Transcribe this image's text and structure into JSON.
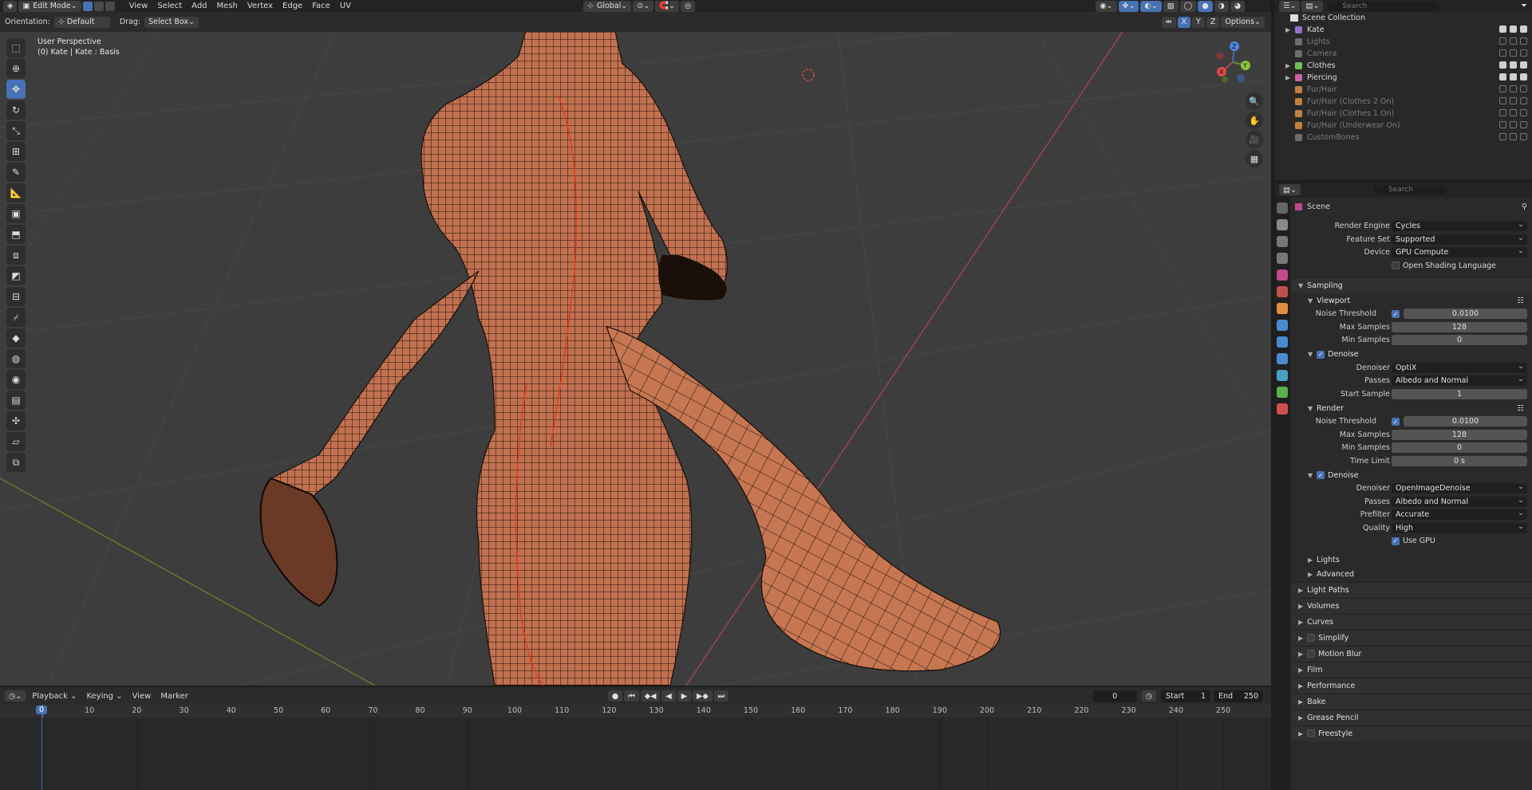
{
  "header": {
    "mode": "Edit Mode",
    "menus": [
      "View",
      "Select",
      "Add",
      "Mesh",
      "Vertex",
      "Edge",
      "Face",
      "UV"
    ],
    "transform_orientation": "Global",
    "options": "Options",
    "axes": [
      "X",
      "Y",
      "Z"
    ]
  },
  "tool_settings": {
    "orientation_label": "Orientation:",
    "orientation_value": "Default",
    "drag_label": "Drag:",
    "drag_value": "Select Box"
  },
  "viewport": {
    "info_line1": "User Perspective",
    "info_line2": "(0) Kate | Kate : Basis",
    "gizmo_axes": [
      "X",
      "Y",
      "Z"
    ]
  },
  "timeline": {
    "menus": [
      "Playback",
      "Keying",
      "View",
      "Marker"
    ],
    "current_frame": "0",
    "start_label": "Start",
    "start_value": "1",
    "end_label": "End",
    "end_value": "250",
    "ticks": [
      "0",
      "10",
      "20",
      "30",
      "40",
      "50",
      "60",
      "70",
      "80",
      "90",
      "100",
      "110",
      "120",
      "130",
      "140",
      "150",
      "160",
      "170",
      "180",
      "190",
      "200",
      "210",
      "220",
      "230",
      "240",
      "250"
    ]
  },
  "outliner": {
    "search_placeholder": "Search",
    "root": "Scene Collection",
    "items": [
      {
        "name": "Kate",
        "dim": false,
        "color": "#9a6fd0",
        "expand": true
      },
      {
        "name": "Lights",
        "dim": true,
        "color": "#6e6e6e",
        "expand": false
      },
      {
        "name": "Camera",
        "dim": true,
        "color": "#6e6e6e",
        "expand": false
      },
      {
        "name": "Clothes",
        "dim": false,
        "color": "#6fbf5a",
        "expand": true
      },
      {
        "name": "Piercing",
        "dim": false,
        "color": "#d05fa6",
        "expand": true
      },
      {
        "name": "Fur/Hair",
        "dim": true,
        "color": "#c08040",
        "expand": false
      },
      {
        "name": "Fur/Hair (Clothes 2 On)",
        "dim": true,
        "color": "#c08040",
        "expand": false
      },
      {
        "name": "Fur/Hair (Clothes 1 On)",
        "dim": true,
        "color": "#c08040",
        "expand": false
      },
      {
        "name": "Fur/Hair (Underwear On)",
        "dim": true,
        "color": "#c08040",
        "expand": false
      },
      {
        "name": "CustomBones",
        "dim": true,
        "color": "#6e6e6e",
        "expand": false
      }
    ]
  },
  "properties": {
    "search_placeholder": "Search",
    "context": "Scene",
    "render_engine_label": "Render Engine",
    "render_engine": "Cycles",
    "feature_set_label": "Feature Set",
    "feature_set": "Supported",
    "device_label": "Device",
    "device": "GPU Compute",
    "osl_label": "Open Shading Language",
    "sampling": "Sampling",
    "viewport": "Viewport",
    "noise_threshold_label": "Noise Threshold",
    "vp_noise_threshold": "0.0100",
    "max_samples_label": "Max Samples",
    "vp_max_samples": "128",
    "min_samples_label": "Min Samples",
    "vp_min_samples": "0",
    "denoise": "Denoise",
    "denoiser_label": "Denoiser",
    "vp_denoiser": "OptiX",
    "passes_label": "Passes",
    "vp_passes": "Albedo and Normal",
    "start_sample_label": "Start Sample",
    "vp_start_sample": "1",
    "render": "Render",
    "r_noise_threshold": "0.0100",
    "r_max_samples": "128",
    "r_min_samples": "0",
    "time_limit_label": "Time Limit",
    "r_time_limit": "0 s",
    "r_denoiser": "OpenImageDenoise",
    "r_passes": "Albedo and Normal",
    "prefilter_label": "Prefilter",
    "r_prefilter": "Accurate",
    "quality_label": "Quality",
    "r_quality": "High",
    "use_gpu_label": "Use GPU",
    "lights": "Lights",
    "advanced": "Advanced",
    "panels": [
      "Light Paths",
      "Volumes",
      "Curves",
      "Simplify",
      "Motion Blur",
      "Film",
      "Performance",
      "Bake",
      "Grease Pencil",
      "Freestyle"
    ]
  }
}
